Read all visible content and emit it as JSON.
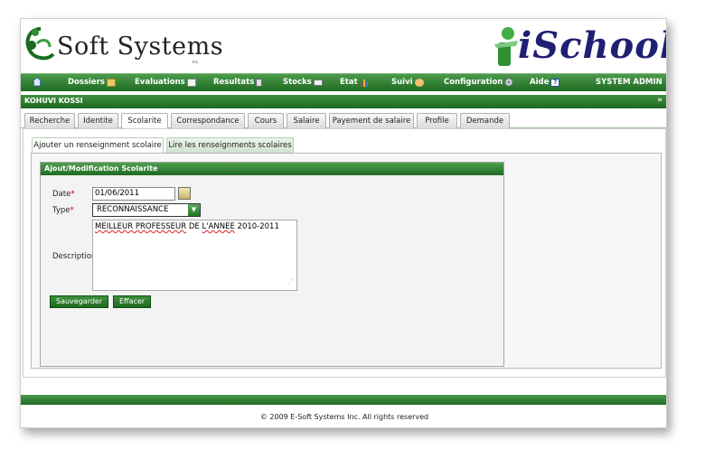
{
  "header": {
    "left_logo": "Soft Systems",
    "left_logo_inc": "Inc.",
    "right_logo": "iSchool"
  },
  "menu": {
    "items": [
      {
        "label": "Dossiers",
        "icon": "folder-icon"
      },
      {
        "label": "Evaluations",
        "icon": "pencil-icon"
      },
      {
        "label": "Resultats",
        "icon": "report-icon"
      },
      {
        "label": "Stocks",
        "icon": "envelope-icon"
      },
      {
        "label": "Etat",
        "icon": "bar-chart-icon"
      },
      {
        "label": "Suivi",
        "icon": "people-icon"
      },
      {
        "label": "Configuration",
        "icon": "gear-icon"
      },
      {
        "label": "Aide",
        "icon": "help-icon"
      }
    ],
    "user": "SYSTEM ADMIN"
  },
  "namebar": {
    "name": "KOHUVI KOSSI",
    "expand": "»"
  },
  "tabs": [
    {
      "label": "Recherche"
    },
    {
      "label": "Identite"
    },
    {
      "label": "Scolarite"
    },
    {
      "label": "Correspondance"
    },
    {
      "label": "Cours"
    },
    {
      "label": "Salaire"
    },
    {
      "label": "Payement de salaire"
    },
    {
      "label": "Profile"
    },
    {
      "label": "Demande"
    }
  ],
  "subtabs": [
    {
      "label": "Ajouter un renseignment scolaire"
    },
    {
      "label": "Lire les renseignments scolaires"
    }
  ],
  "form": {
    "title": "Ajout/Modification Scolarite",
    "date_label": "Date",
    "date_value": "01/06/2011",
    "type_label": "Type",
    "type_value": "RECONNAISSANCE",
    "required_mark": "*",
    "description_label": "Description",
    "description_value_a": "MEILLEUR PROFESSEUR",
    "description_value_b": " DE ",
    "description_value_c": "L'ANNEE",
    "description_value_d": " 2010-2011",
    "save_label": "Sauvegarder",
    "clear_label": "Effacer"
  },
  "footer": {
    "copyright": "© 2009 E-Soft Systems Inc. All rights reserved"
  },
  "colors": {
    "green_dark": "#1f6b22",
    "green_light": "#4c9a4c",
    "logo_navy": "#1f1f73",
    "required": "#cc0000"
  }
}
